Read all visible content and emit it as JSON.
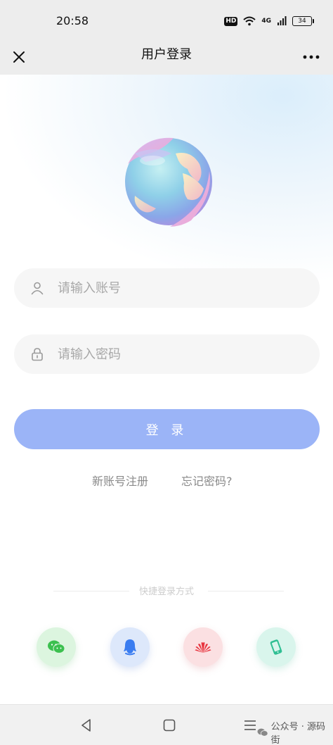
{
  "status_bar": {
    "time": "20:58",
    "hd_label": "HD",
    "network_label": "4G",
    "battery_level": "34"
  },
  "nav": {
    "title": "用户登录",
    "close_icon": "close-icon",
    "more_icon": "more-icon"
  },
  "hero": {
    "image": "globe-illustration"
  },
  "form": {
    "account_placeholder": "请输入账号",
    "account_value": "",
    "password_placeholder": "请输入密码",
    "password_value": "",
    "login_label": "登 录"
  },
  "links": {
    "register": "新账号注册",
    "forgot": "忘记密码?"
  },
  "quick_login": {
    "label": "快捷登录方式",
    "options": [
      {
        "icon": "wechat-icon",
        "color": "#3cc04f"
      },
      {
        "icon": "qq-icon",
        "color": "#3a7cf0"
      },
      {
        "icon": "huawei-icon",
        "color": "#e8343f"
      },
      {
        "icon": "phone-icon",
        "color": "#2fbf93"
      }
    ]
  },
  "system_nav": {
    "watermark": "公众号 · 源码街"
  },
  "colors": {
    "accent": "#9bb4f7",
    "input_bg": "#f6f6f6",
    "link": "#8a8a8a"
  }
}
